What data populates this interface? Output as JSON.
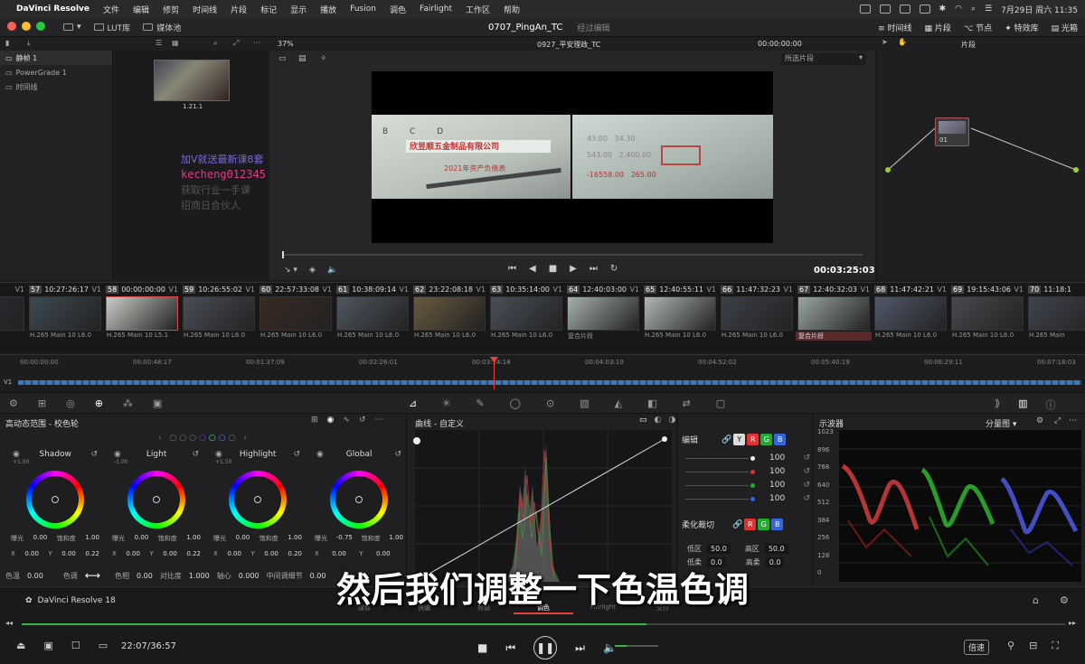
{
  "menubar": {
    "app": "DaVinci Resolve",
    "items": [
      "文件",
      "编辑",
      "修剪",
      "时间线",
      "片段",
      "标记",
      "显示",
      "播放",
      "Fusion",
      "调色",
      "Fairlight",
      "工作区",
      "帮助"
    ],
    "clock": "7月29日 周六 11:35"
  },
  "titlebar": {
    "buttons": [
      "LUT库",
      "媒体池"
    ],
    "project": "0707_PingAn_TC",
    "status": "经过编辑",
    "right": [
      "时间线",
      "片段",
      "节点",
      "特效库",
      "光箱"
    ]
  },
  "toolbar2": {
    "zoom": "37%",
    "timeline": "0927_平安理政_TC",
    "timecode": "00:00:00:00",
    "clip_label": "片段"
  },
  "viewer": {
    "mode": "所选片段",
    "duration": "00:03:25:03"
  },
  "leftpanel": {
    "items": [
      "静帧 1",
      "PowerGrade 1",
      "时间线"
    ]
  },
  "gallery": {
    "thumb_label": "1.21.1"
  },
  "watermark": {
    "lines": [
      "加V就送最新课8套",
      "kecheng012345",
      "获取行业一手课",
      "招商日合伙人"
    ]
  },
  "nodes": {
    "node_label": "01"
  },
  "clips": [
    {
      "num": "",
      "tc": "13:04",
      "track": "V1",
      "codec": "10 L6.0"
    },
    {
      "num": "57",
      "tc": "10:27:26:17",
      "track": "V1",
      "codec": "H.265 Main 10 L6.0"
    },
    {
      "num": "58",
      "tc": "00:00:00:00",
      "track": "V1",
      "codec": "H.265 Main 10 L5.1"
    },
    {
      "num": "59",
      "tc": "10:26:55:02",
      "track": "V1",
      "codec": "H.265 Main 10 L6.0"
    },
    {
      "num": "60",
      "tc": "22:57:33:08",
      "track": "V1",
      "codec": "H.265 Main 10 L6.0"
    },
    {
      "num": "61",
      "tc": "10:38:09:14",
      "track": "V1",
      "codec": "H.265 Main 10 L6.0"
    },
    {
      "num": "62",
      "tc": "23:22:08:18",
      "track": "V1",
      "codec": "H.265 Main 10 L6.0"
    },
    {
      "num": "63",
      "tc": "10:35:14:00",
      "track": "V1",
      "codec": "H.265 Main 10 L6.0"
    },
    {
      "num": "64",
      "tc": "12:40:03:00",
      "track": "V1",
      "codec": "复合片段"
    },
    {
      "num": "65",
      "tc": "12:40:55:11",
      "track": "V1",
      "codec": "H.265 Main 10 L6.0"
    },
    {
      "num": "66",
      "tc": "11:47:32:23",
      "track": "V1",
      "codec": "H.265 Main 10 L6.0"
    },
    {
      "num": "67",
      "tc": "12:40:32:03",
      "track": "V1",
      "codec": "复合片段"
    },
    {
      "num": "68",
      "tc": "11:47:42:21",
      "track": "V1",
      "codec": "H.265 Main 10 L6.0"
    },
    {
      "num": "69",
      "tc": "19:15:43:06",
      "track": "V1",
      "codec": "H.265 Main 10 L6.0"
    },
    {
      "num": "70",
      "tc": "11:18:1",
      "track": "V1",
      "codec": "H.265 Main"
    }
  ],
  "ruler": {
    "marks": [
      "00:00:00:00",
      "00:00:48:17",
      "00:01:37:09",
      "00:02:26:01",
      "00:03:14:18",
      "00:04:03:10",
      "00:04:52:02",
      "00:05:40:19",
      "00:06:29:11",
      "00:07:18:03"
    ],
    "track": "V1"
  },
  "wheels": {
    "title": "高动态范围 - 校色轮",
    "items": [
      {
        "name": "Shadow",
        "top": "+1.00",
        "exp": "0.00",
        "sat": "1.00",
        "x": "0.00",
        "y": "0.00",
        "z": "0.22"
      },
      {
        "name": "Light",
        "top": "-1.00",
        "exp": "0.00",
        "sat": "1.00",
        "x": "0.00",
        "y": "0.00",
        "z": "0.22"
      },
      {
        "name": "Highlight",
        "top": "+1.50",
        "exp": "0.00",
        "sat": "1.00",
        "x": "0.00",
        "y": "0.00",
        "z": "0.20"
      },
      {
        "name": "Global",
        "top": "",
        "exp": "-0.75",
        "sat": "1.00",
        "x": "0.00",
        "y": "0.00",
        "z": ""
      }
    ],
    "labels": {
      "exp": "曝光",
      "sat": "饱和度",
      "x": "X",
      "y": "Y"
    },
    "bottom": {
      "c1": "色温",
      "v1": "0.00",
      "c2": "色调",
      "c3": "色相",
      "v3": "0.00",
      "c4": "对比度",
      "v4": "1.000",
      "c5": "轴心",
      "v5": "0.000",
      "c6": "中间调细节",
      "v6": "0.00"
    }
  },
  "curves": {
    "title": "曲线 - 自定义"
  },
  "rgb": {
    "edit": "编辑",
    "y": "Y",
    "r": "R",
    "g": "G",
    "b": "B",
    "vals": [
      "100",
      "100",
      "100",
      "100"
    ],
    "soft": "柔化裁切",
    "low": "低区",
    "lowv": "50.0",
    "high": "高区",
    "highv": "50.0",
    "ls": "低柔",
    "lsv": "0.0",
    "hs": "高柔",
    "hsv": "0.0"
  },
  "scope": {
    "title": "示波器",
    "mode": "分量图",
    "ticks": [
      "1023",
      "896",
      "768",
      "640",
      "512",
      "384",
      "256",
      "128",
      "0"
    ]
  },
  "pagebar": {
    "brand": "DaVinci Resolve 18",
    "pages": [
      "媒体",
      "快编",
      "剪辑",
      "调色",
      "Fairlight",
      "交付"
    ],
    "active": "调色"
  },
  "player": {
    "time": "22:07/36:57",
    "speed": "倍速"
  },
  "subtitle": "然后我们调整一下色温色调",
  "colors": {
    "accent": "#e6413a",
    "green": "#3bb34a",
    "blue": "#3b6fd6"
  }
}
